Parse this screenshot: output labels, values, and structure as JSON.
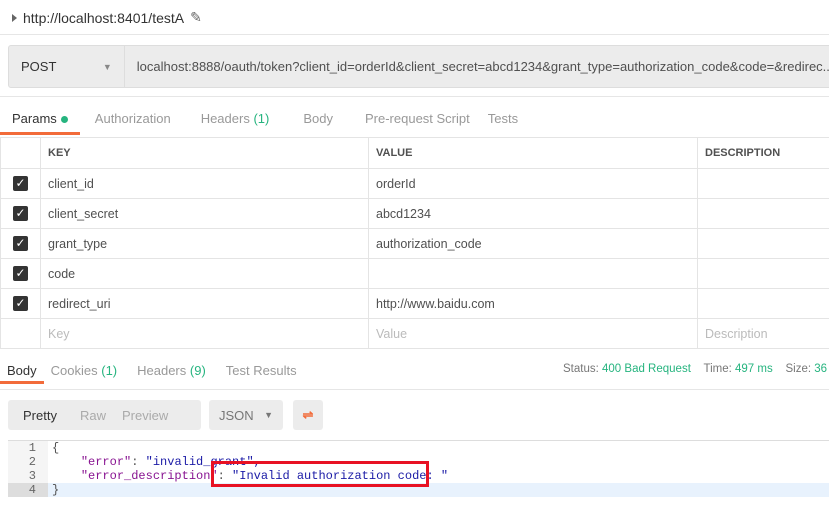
{
  "request": {
    "title": "http://localhost:8401/testA",
    "method": "POST",
    "url": "localhost:8888/oauth/token?client_id=orderId&client_secret=abcd1234&grant_type=authorization_code&code=&redirec..."
  },
  "tabs": [
    {
      "label": "Params"
    },
    {
      "label": "Authorization"
    },
    {
      "label": "Headers",
      "count": "(1)"
    },
    {
      "label": "Body"
    },
    {
      "label": "Pre-request Script"
    },
    {
      "label": "Tests"
    }
  ],
  "params": {
    "headers": [
      "KEY",
      "VALUE",
      "DESCRIPTION"
    ],
    "rows": [
      {
        "key": "client_id",
        "value": "orderId"
      },
      {
        "key": "client_secret",
        "value": "abcd1234"
      },
      {
        "key": "grant_type",
        "value": "authorization_code"
      },
      {
        "key": "code",
        "value": ""
      },
      {
        "key": "redirect_uri",
        "value": "http://www.baidu.com"
      }
    ],
    "placeholders": {
      "key": "Key",
      "value": "Value",
      "description": "Description"
    }
  },
  "response": {
    "tabs": [
      {
        "label": "Body"
      },
      {
        "label": "Cookies",
        "count": "(1)"
      },
      {
        "label": "Headers",
        "count": "(9)"
      },
      {
        "label": "Test Results"
      }
    ],
    "status_label": "Status:",
    "status": "400 Bad Request",
    "time_label": "Time:",
    "time": "497 ms",
    "size_label": "Size:",
    "size": "36",
    "views": [
      "Pretty",
      "Raw",
      "Preview"
    ],
    "format": "JSON",
    "lines": [
      {
        "n": "1",
        "t": "{"
      },
      {
        "n": "2",
        "k": "\"error\"",
        "v": "\"invalid_grant\","
      },
      {
        "n": "3",
        "k": "\"error_description\"",
        "v": "\"Invalid authorization code: \""
      },
      {
        "n": "4",
        "t": "}"
      }
    ]
  },
  "colors": {
    "accent": "#f26b3a",
    "green": "#26b47f",
    "highlight": "#e81123"
  }
}
